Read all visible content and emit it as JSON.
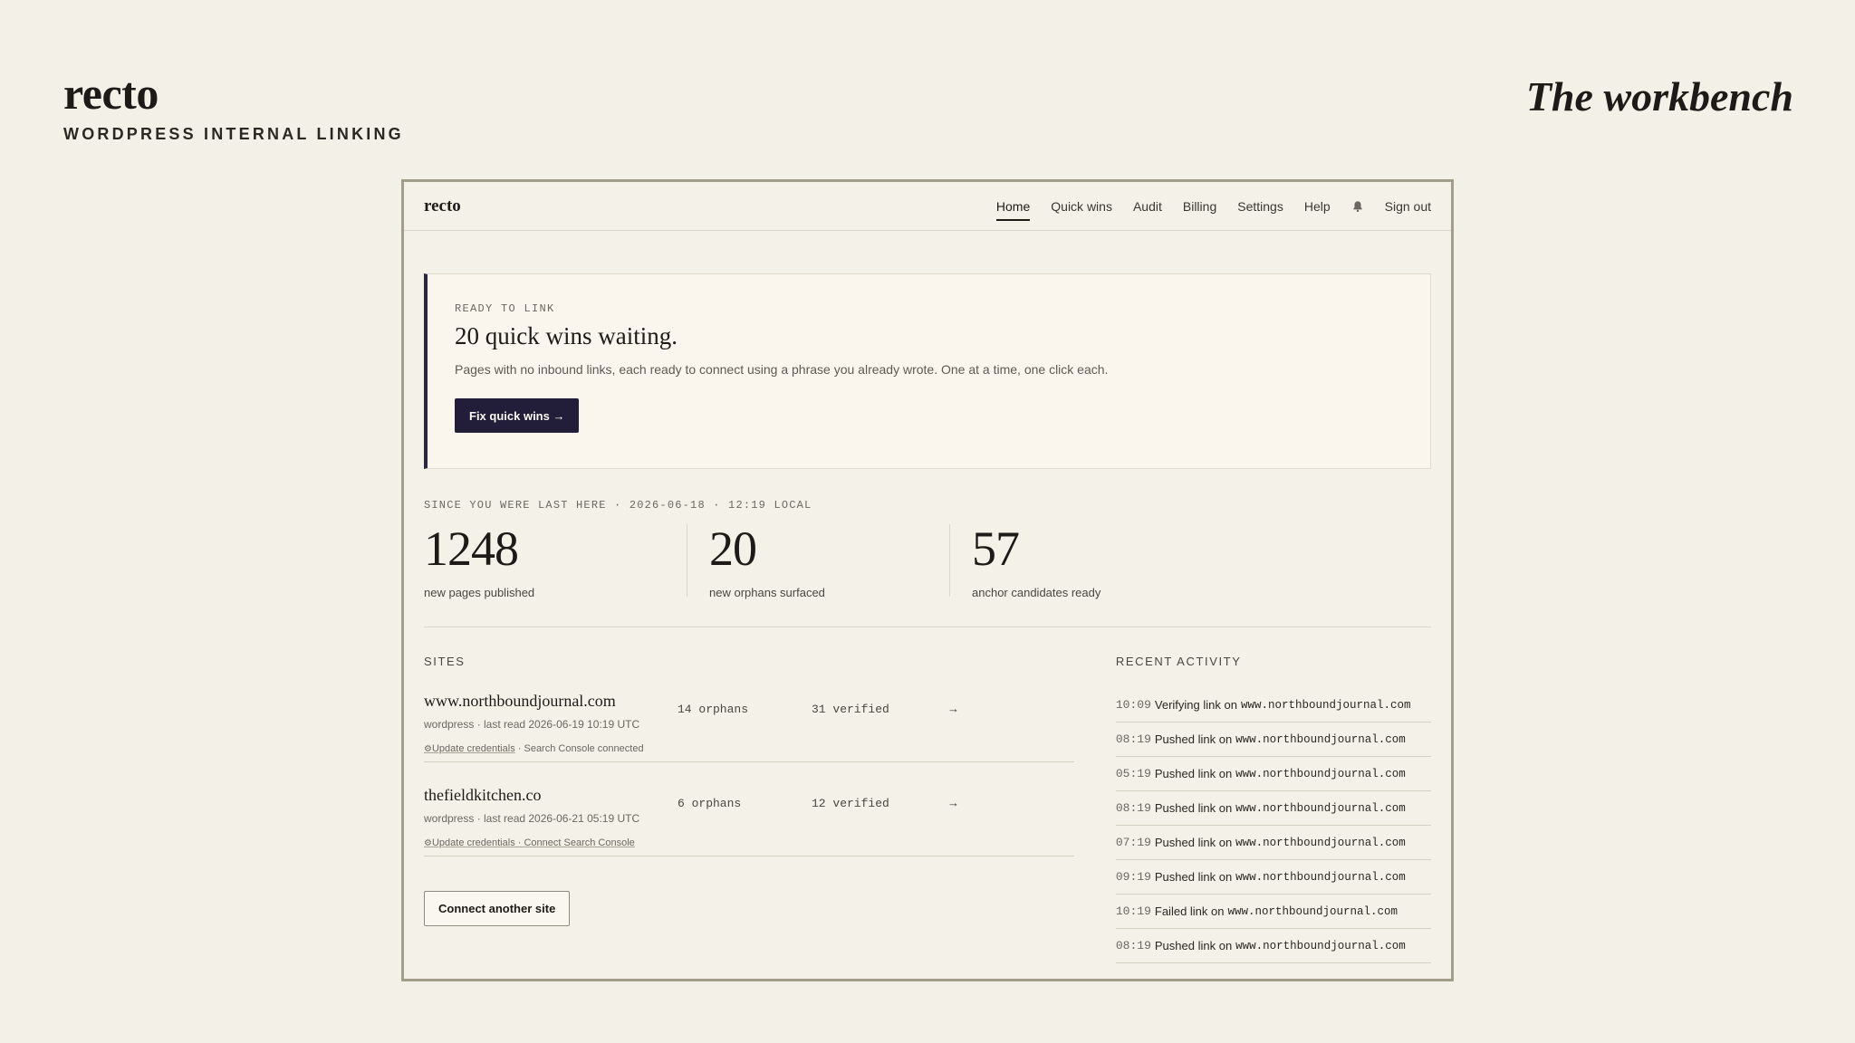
{
  "slide": {
    "brand_name": "recto",
    "brand_tagline": "WORDPRESS INTERNAL LINKING",
    "title": "The workbench"
  },
  "nav": {
    "logo": "recto",
    "links": [
      "Home",
      "Quick wins",
      "Audit",
      "Billing",
      "Settings",
      "Help"
    ],
    "active": "Home",
    "bell_icon": "bell-icon",
    "sign_out": "Sign out"
  },
  "hero": {
    "eyebrow": "READY TO LINK",
    "title": "20 quick wins waiting.",
    "description": "Pages with no inbound links, each ready to connect using a phrase you already wrote. One at a time, one click each.",
    "button": "Fix quick wins →"
  },
  "since": {
    "label": "SINCE YOU WERE LAST HERE · 2026-06-18 · 12:19 LOCAL",
    "stats": [
      {
        "value": "1248",
        "label": "new pages published"
      },
      {
        "value": "20",
        "label": "new orphans surfaced"
      },
      {
        "value": "57",
        "label": "anchor candidates ready"
      }
    ]
  },
  "sites": {
    "label": "SITES",
    "items": [
      {
        "name": "www.northboundjournal.com",
        "meta": "wordpress · last read 2026-06-19 10:19 UTC",
        "orphans": "14 orphans",
        "verified": "31 verified",
        "arrow": "→",
        "gear_icon": "⚙",
        "link1": "Update credentials",
        "sep": " · ",
        "status": "Search Console connected",
        "status_is_link": false
      },
      {
        "name": "thefieldkitchen.co",
        "meta": "wordpress · last read 2026-06-21 05:19 UTC",
        "orphans": "6 orphans",
        "verified": "12 verified",
        "arrow": "→",
        "gear_icon": "⚙",
        "link1": "Update credentials",
        "sep": " · ",
        "status": "Connect Search Console",
        "status_is_link": true
      }
    ],
    "connect_button": "Connect another site"
  },
  "activity": {
    "label": "RECENT ACTIVITY",
    "items": [
      {
        "time": "10:09",
        "text": "Verifying link on",
        "domain": "www.northboundjournal.com"
      },
      {
        "time": "08:19",
        "text": "Pushed link on",
        "domain": "www.northboundjournal.com"
      },
      {
        "time": "05:19",
        "text": "Pushed link on",
        "domain": "www.northboundjournal.com"
      },
      {
        "time": "08:19",
        "text": "Pushed link on",
        "domain": "www.northboundjournal.com"
      },
      {
        "time": "07:19",
        "text": "Pushed link on",
        "domain": "www.northboundjournal.com"
      },
      {
        "time": "09:19",
        "text": "Pushed link on",
        "domain": "www.northboundjournal.com"
      },
      {
        "time": "10:19",
        "text": "Failed link on",
        "domain": "www.northboundjournal.com"
      },
      {
        "time": "08:19",
        "text": "Pushed link on",
        "domain": "www.northboundjournal.com"
      }
    ]
  }
}
